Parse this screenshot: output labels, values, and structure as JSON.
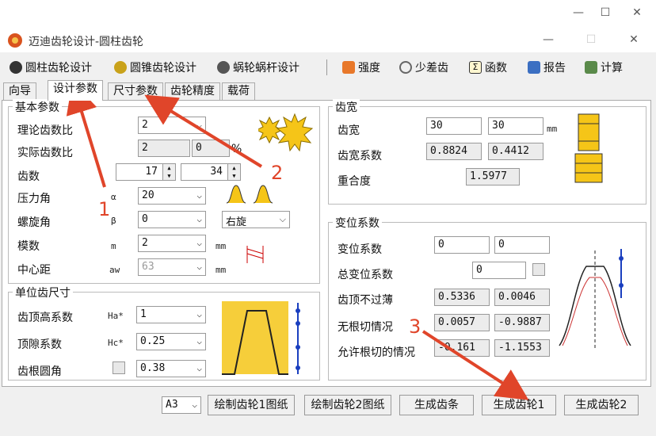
{
  "window": {
    "title": "迈迪齿轮设计-圆柱齿轮"
  },
  "toolbar": {
    "cyl": "圆柱齿轮设计",
    "bevel": "圆锥齿轮设计",
    "worm": "蜗轮蜗杆设计",
    "strength": "强度",
    "diff": "少差齿",
    "func": "函数",
    "report": "报告",
    "calc": "计算"
  },
  "tabs": [
    "向导",
    "设计参数",
    "尺寸参数",
    "齿轮精度",
    "载荷"
  ],
  "basic": {
    "title": "基本参数",
    "theory_ratio": {
      "label": "理论齿数比",
      "value": "2"
    },
    "actual_ratio": {
      "label": "实际齿数比",
      "value1": "2",
      "value2": "0",
      "unit": "%"
    },
    "teeth": {
      "label": "齿数",
      "z1": "17",
      "z2": "34"
    },
    "pressure": {
      "label": "压力角",
      "sym": "α",
      "value": "20"
    },
    "helix": {
      "label": "螺旋角",
      "sym": "β",
      "value": "0",
      "dir": "右旋"
    },
    "module": {
      "label": "模数",
      "sym": "m",
      "value": "2",
      "unit": "mm"
    },
    "center": {
      "label": "中心距",
      "sym": "aw",
      "value": "63",
      "unit": "mm"
    }
  },
  "unit_size": {
    "title": "单位齿尺寸",
    "addendum": {
      "label": "齿顶高系数",
      "sym": "Ha*",
      "value": "1"
    },
    "clearance": {
      "label": "顶隙系数",
      "sym": "Hc*",
      "value": "0.25"
    },
    "root": {
      "label": "齿根圆角",
      "value": "0.38"
    }
  },
  "width": {
    "title": "齿宽",
    "width": {
      "label": "齿宽",
      "v1": "30",
      "v2": "30",
      "unit": "mm"
    },
    "coef": {
      "label": "齿宽系数",
      "v1": "0.8824",
      "v2": "0.4412"
    },
    "overlap": {
      "label": "重合度",
      "value": "1.5977"
    }
  },
  "shift": {
    "title": "变位系数",
    "shift": {
      "label": "变位系数",
      "v1": "0",
      "v2": "0"
    },
    "total": {
      "label": "总变位系数",
      "value": "0"
    },
    "tip": {
      "label": "齿顶不过薄",
      "v1": "0.5336",
      "v2": "0.0046"
    },
    "noundercut": {
      "label": "无根切情况",
      "v1": "0.0057",
      "v2": "-0.9887"
    },
    "allow": {
      "label": "允许根切的情况",
      "v1": "-0.161",
      "v2": "-1.1553"
    }
  },
  "bottom": {
    "paper": "A3",
    "draw1": "绘制齿轮1图纸",
    "draw2": "绘制齿轮2图纸",
    "rack": "生成齿条",
    "gen1": "生成齿轮1",
    "gen2": "生成齿轮2"
  },
  "annotations": [
    "1",
    "2",
    "3"
  ],
  "colors": {
    "arrow": "#e0452a",
    "gear": "#f5c518"
  }
}
